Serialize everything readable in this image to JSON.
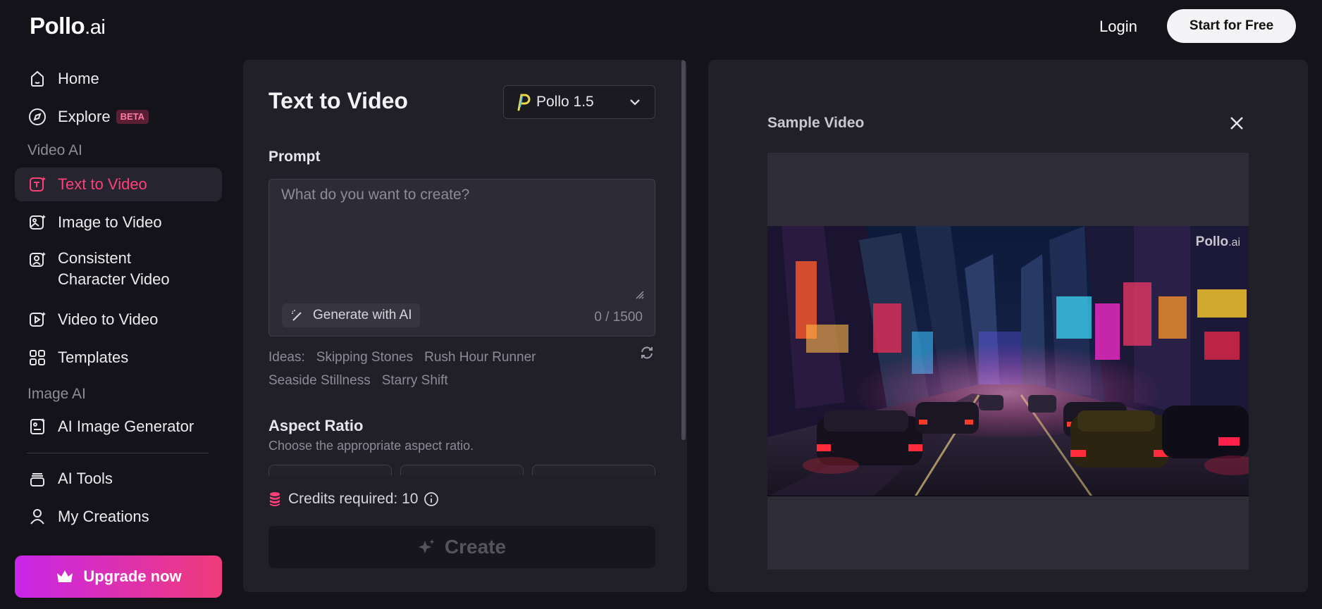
{
  "header": {
    "logo_main": "Pollo",
    "logo_suffix": ".ai",
    "login_label": "Login",
    "start_label": "Start for Free"
  },
  "sidebar": {
    "home": "Home",
    "explore": "Explore",
    "explore_badge": "BETA",
    "section_video": "Video AI",
    "text_to_video": "Text to Video",
    "image_to_video": "Image to Video",
    "consistent_line1": "Consistent",
    "consistent_line2": "Character Video",
    "video_to_video": "Video to Video",
    "templates": "Templates",
    "section_image": "Image AI",
    "ai_image_generator": "AI Image Generator",
    "ai_tools": "AI Tools",
    "my_creations": "My Creations",
    "upgrade": "Upgrade now"
  },
  "form": {
    "title": "Text to Video",
    "model": "Pollo 1.5",
    "prompt_label": "Prompt",
    "prompt_placeholder": "What do you want to create?",
    "generate_label": "Generate with AI",
    "char_count": "0 / 1500",
    "ideas_label": "Ideas:",
    "ideas": [
      "Skipping Stones",
      "Rush Hour Runner",
      "Seaside Stillness",
      "Starry Shift"
    ],
    "aspect_label": "Aspect Ratio",
    "aspect_hint": "Choose the appropriate aspect ratio.",
    "credits": "Credits required: 10",
    "create_label": "Create"
  },
  "sample": {
    "title": "Sample Video",
    "watermark_main": "Pollo",
    "watermark_suffix": ".ai"
  },
  "colors": {
    "accent": "#ff3f77",
    "upgrade_gradient_start": "#c826e9",
    "upgrade_gradient_end": "#f03b7a"
  }
}
